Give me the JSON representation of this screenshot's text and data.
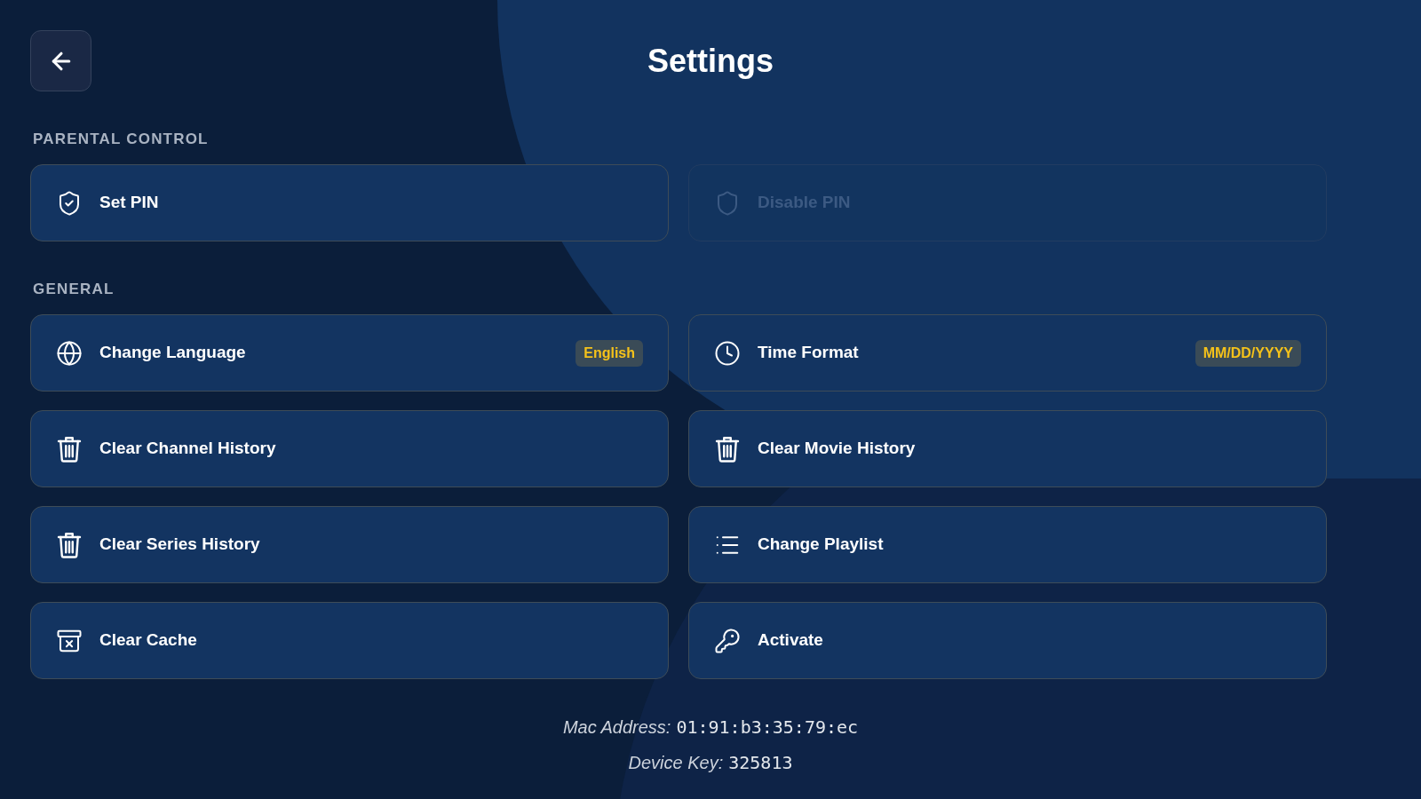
{
  "header": {
    "title": "Settings"
  },
  "sections": [
    {
      "heading": "PARENTAL CONTROL",
      "items": [
        {
          "label": "Set PIN",
          "disabled": false
        },
        {
          "label": "Disable PIN",
          "disabled": true
        }
      ]
    },
    {
      "heading": "GENERAL",
      "items": [
        {
          "label": "Change Language",
          "value": "English",
          "disabled": false
        },
        {
          "label": "Time Format",
          "value": "MM/DD/YYYY",
          "disabled": false
        },
        {
          "label": "Clear Channel History",
          "disabled": false
        },
        {
          "label": "Clear Movie History",
          "disabled": false
        },
        {
          "label": "Clear Series History",
          "disabled": false
        },
        {
          "label": "Change Playlist",
          "disabled": false
        },
        {
          "label": "Clear Cache",
          "disabled": false
        },
        {
          "label": "Activate",
          "disabled": false
        }
      ]
    }
  ],
  "device_info": [
    {
      "label": "Mac Address:",
      "value": "01:91:b3:35:79:ec"
    },
    {
      "label": "Device Key:",
      "value": "325813"
    }
  ]
}
